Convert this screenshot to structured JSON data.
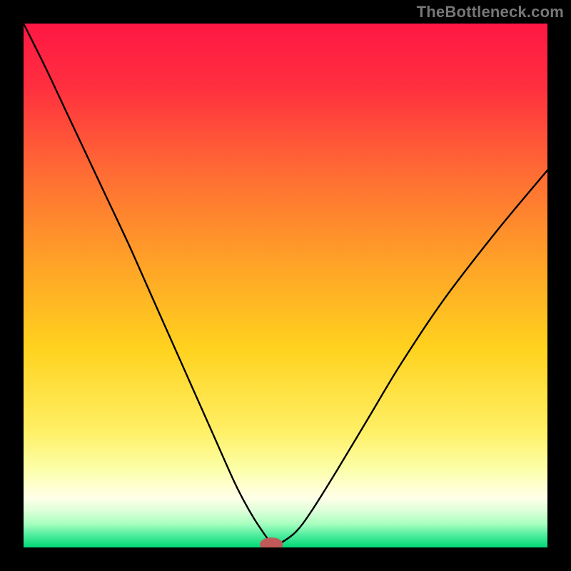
{
  "watermark": "TheBottleneck.com",
  "chart_data": {
    "type": "line",
    "title": "",
    "xlabel": "",
    "ylabel": "",
    "xlim": [
      0,
      100
    ],
    "ylim": [
      0,
      100
    ],
    "grid": false,
    "legend": false,
    "annotations": [],
    "background": {
      "type": "vertical-gradient",
      "stops": [
        {
          "pos": 0.0,
          "color": "#ff1744"
        },
        {
          "pos": 0.12,
          "color": "#ff2f3f"
        },
        {
          "pos": 0.28,
          "color": "#ff6a34"
        },
        {
          "pos": 0.45,
          "color": "#ffa028"
        },
        {
          "pos": 0.62,
          "color": "#ffd21e"
        },
        {
          "pos": 0.78,
          "color": "#fff066"
        },
        {
          "pos": 0.85,
          "color": "#fcffa8"
        },
        {
          "pos": 0.905,
          "color": "#ffffe8"
        },
        {
          "pos": 0.93,
          "color": "#ddffd8"
        },
        {
          "pos": 0.955,
          "color": "#a8ffc0"
        },
        {
          "pos": 0.975,
          "color": "#55eea0"
        },
        {
          "pos": 1.0,
          "color": "#00d876"
        }
      ]
    },
    "series": [
      {
        "name": "bottleneck-curve",
        "color": "#000000",
        "x": [
          0,
          4,
          8,
          12,
          16,
          20,
          24,
          28,
          32,
          36,
          40,
          42,
          44,
          46,
          47,
          48,
          49,
          52,
          55,
          60,
          66,
          72,
          80,
          90,
          100
        ],
        "y": [
          100,
          92,
          83.5,
          75,
          66.5,
          58,
          49,
          40,
          31,
          22,
          13,
          9,
          5.5,
          2.5,
          1.2,
          0.6,
          0.8,
          3,
          7,
          15,
          25,
          35,
          47,
          60,
          72
        ]
      }
    ],
    "marker": {
      "name": "optimal-point",
      "x": 47.3,
      "y": 0.6,
      "rx": 2.2,
      "ry": 1.3,
      "color": "#c05a5a"
    }
  }
}
